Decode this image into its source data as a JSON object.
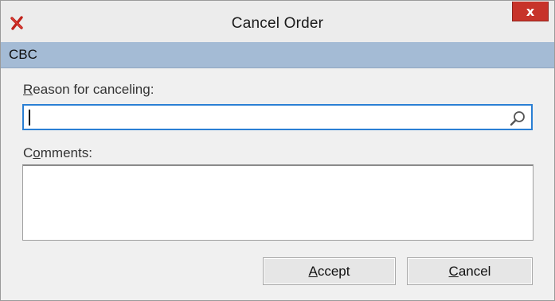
{
  "window": {
    "title": "Cancel Order",
    "close_label": "x"
  },
  "header": {
    "label": "CBC"
  },
  "form": {
    "reason": {
      "label_mnemonic": "R",
      "label_rest": "eason for canceling:",
      "value": ""
    },
    "comments": {
      "label_pre": "C",
      "label_mnemonic": "o",
      "label_rest": "mments:",
      "value": ""
    }
  },
  "buttons": {
    "accept": {
      "mnemonic": "A",
      "rest": "ccept"
    },
    "cancel": {
      "mnemonic": "C",
      "rest": "ancel"
    }
  },
  "colors": {
    "header_band": "#a4bbd5",
    "close_button": "#c7332a",
    "focus_border": "#2a7fd4",
    "app_icon": "#c0221b"
  },
  "icons": {
    "app": "red-x-icon",
    "search": "search-icon",
    "close": "close-icon"
  }
}
